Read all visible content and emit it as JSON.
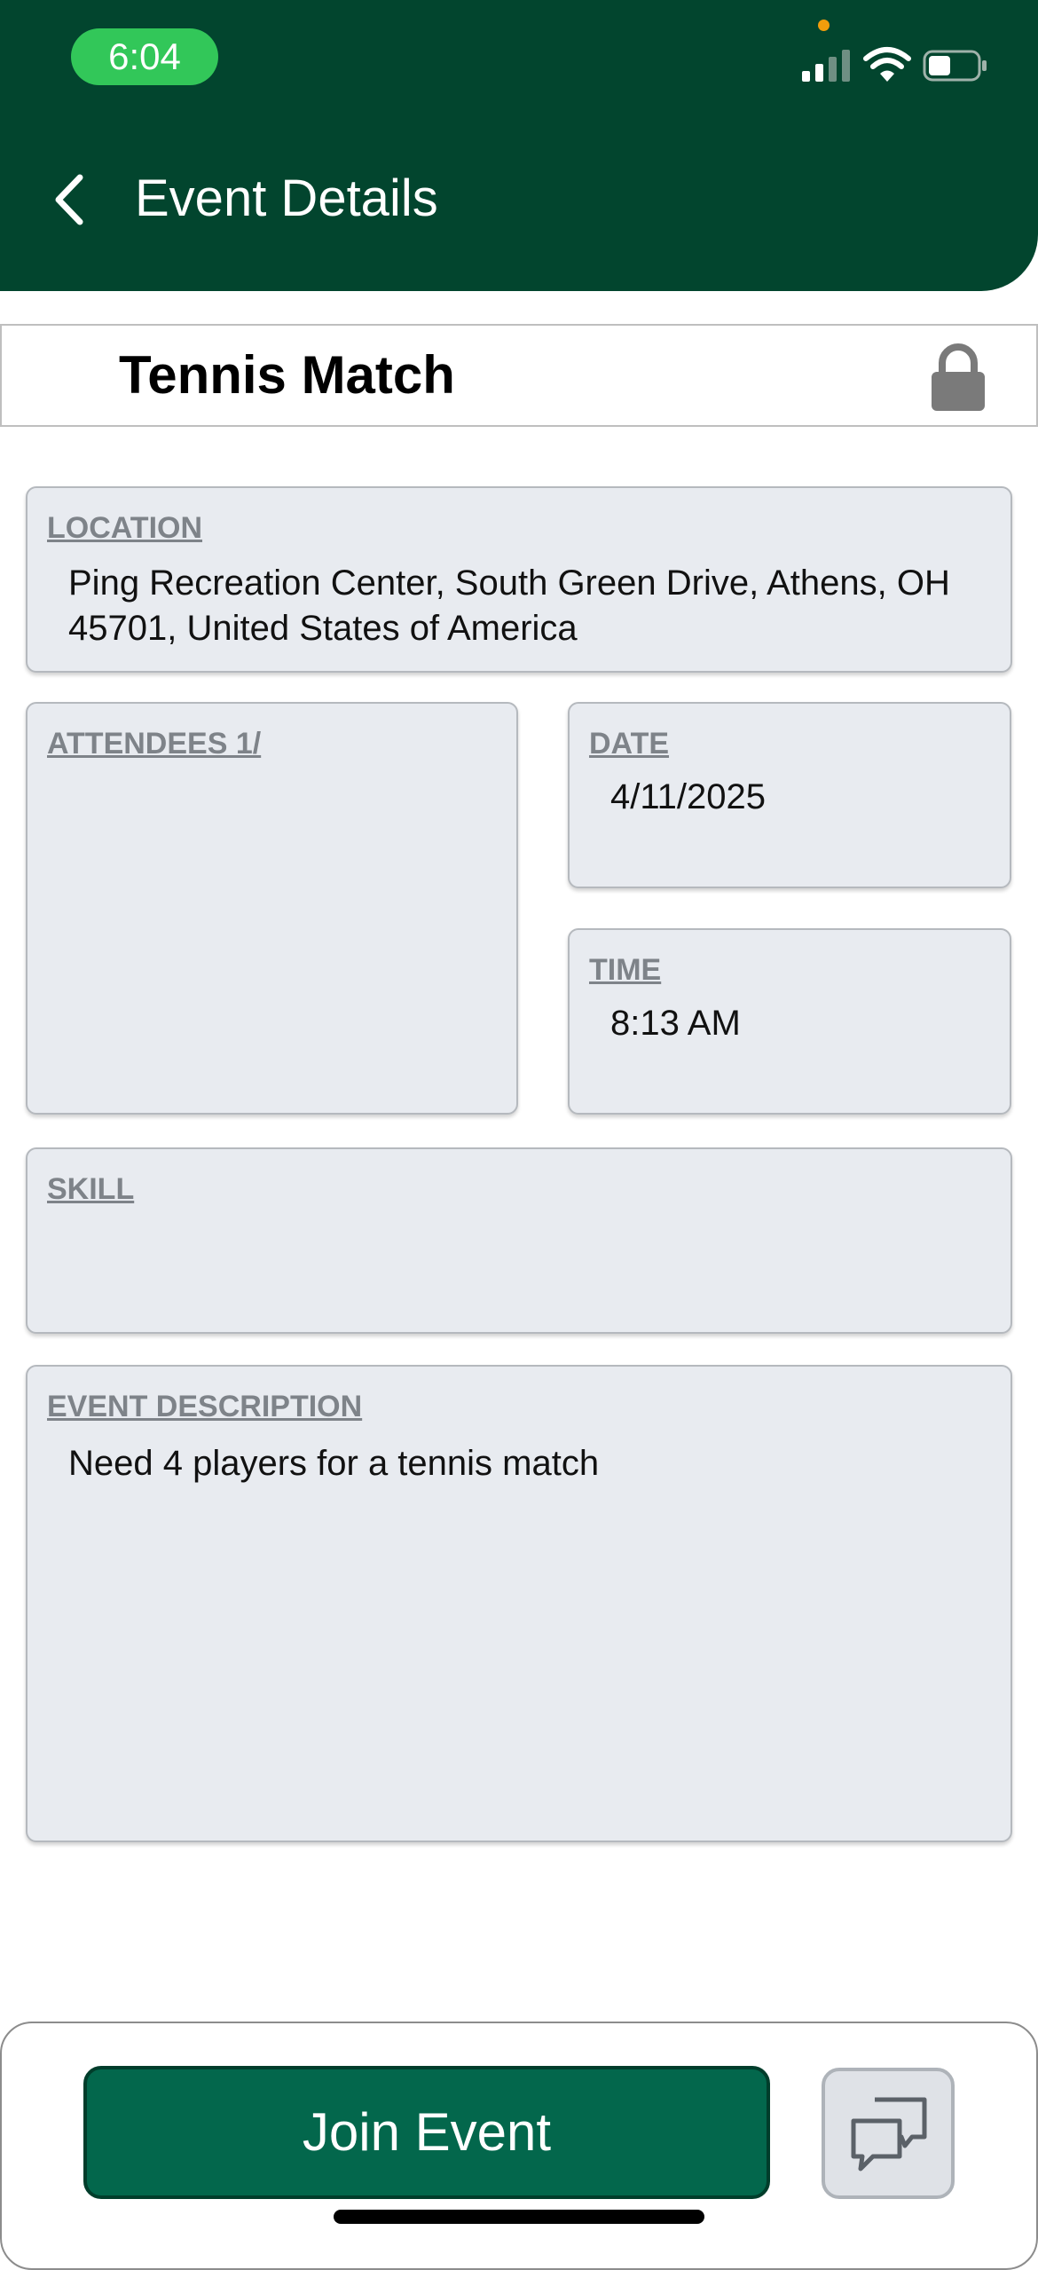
{
  "status_bar": {
    "time": "6:04",
    "icons": [
      "signal-icon",
      "wifi-icon",
      "battery-icon"
    ]
  },
  "header": {
    "back_icon": "chevron-left-icon",
    "title": "Event Details"
  },
  "event": {
    "title": "Tennis Match",
    "lock_icon": "lock-icon"
  },
  "fields": {
    "location_label": "LOCATION",
    "location_value": "Ping Recreation Center, South Green Drive, Athens, OH 45701, United States of America",
    "attendees_label": "ATTENDEES 1/",
    "date_label": "DATE",
    "date_value": "4/11/2025",
    "time_label": "TIME",
    "time_value": "8:13 AM",
    "skill_label": "SKILL",
    "skill_value": "",
    "description_label": "EVENT DESCRIPTION",
    "description_value": "Need 4 players for a tennis match"
  },
  "actions": {
    "join_label": "Join Event",
    "chat_icon": "chat-bubbles-icon"
  },
  "colors": {
    "header": "#02452e",
    "status_time_pill": "#32c759",
    "join_button": "#03674c",
    "card_background": "#e8ebf0",
    "card_label": "#7e8389"
  }
}
